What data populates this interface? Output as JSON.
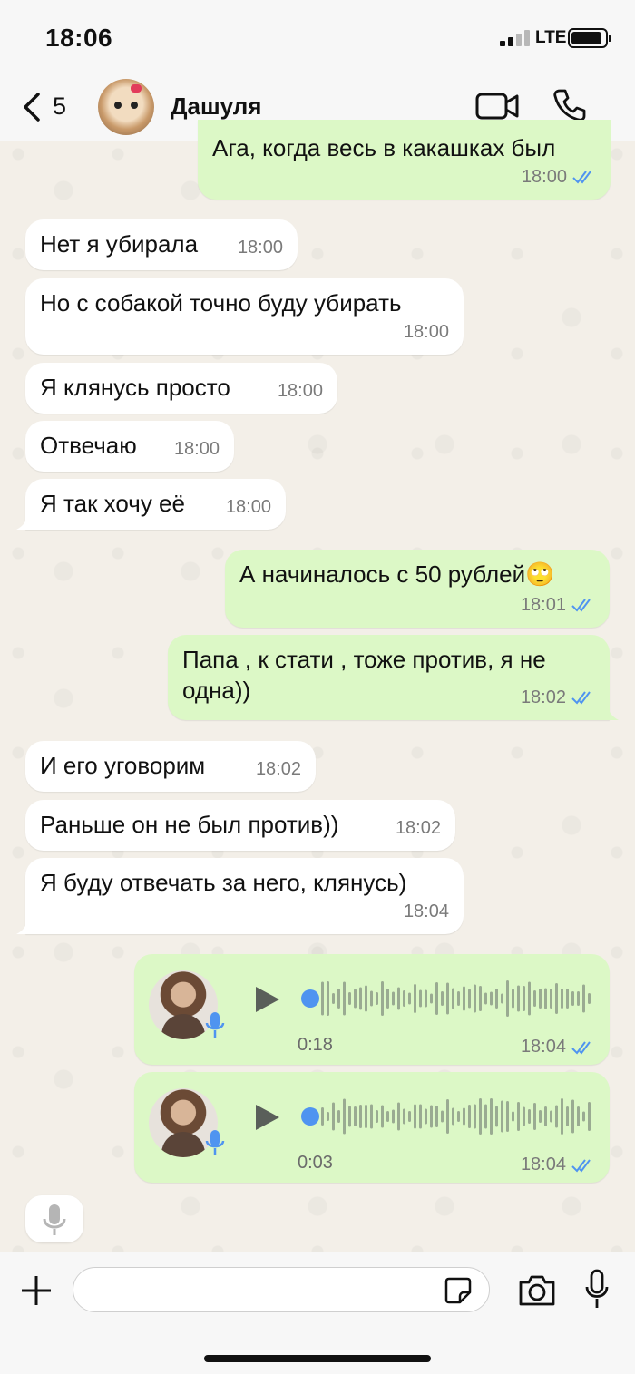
{
  "status_bar": {
    "time": "18:06",
    "network": "LTE"
  },
  "header": {
    "back_count": "5",
    "contact_name": "Дашуля"
  },
  "messages": [
    {
      "dir": "out",
      "text": "Ага, когда весь в какашках был",
      "time": "18:00",
      "read": true
    },
    {
      "dir": "in",
      "text": "Нет я убирала",
      "time": "18:00"
    },
    {
      "dir": "in",
      "text": "Но с собакой точно буду убирать",
      "time": "18:00"
    },
    {
      "dir": "in",
      "text": "Я клянусь просто",
      "time": "18:00"
    },
    {
      "dir": "in",
      "text": "Отвечаю",
      "time": "18:00"
    },
    {
      "dir": "in",
      "text": "Я так хочу её",
      "time": "18:00"
    },
    {
      "dir": "out",
      "text": "А начиналось с 50 рублей🙄",
      "time": "18:01",
      "read": true
    },
    {
      "dir": "out",
      "text": "Папа , к стати , тоже против, я не одна))",
      "time": "18:02",
      "read": true
    },
    {
      "dir": "in",
      "text": "И его уговорим",
      "time": "18:02"
    },
    {
      "dir": "in",
      "text": "Раньше он не был против))",
      "time": "18:02"
    },
    {
      "dir": "in",
      "text": "Я буду отвечать за него, клянусь)",
      "time": "18:04"
    }
  ],
  "voice_messages": [
    {
      "duration": "0:18",
      "time": "18:04",
      "read": true,
      "progress": 0
    },
    {
      "duration": "0:03",
      "time": "18:04",
      "read": true,
      "progress": 0
    }
  ],
  "input": {
    "placeholder": ""
  },
  "colors": {
    "outgoing_bubble": "#dcf8c6",
    "incoming_bubble": "#ffffff",
    "read_ticks": "#4f94f0"
  },
  "icons": [
    "back-chevron-icon",
    "video-call-icon",
    "phone-call-icon",
    "play-icon",
    "microphone-icon",
    "plus-icon",
    "sticker-icon",
    "camera-icon"
  ]
}
